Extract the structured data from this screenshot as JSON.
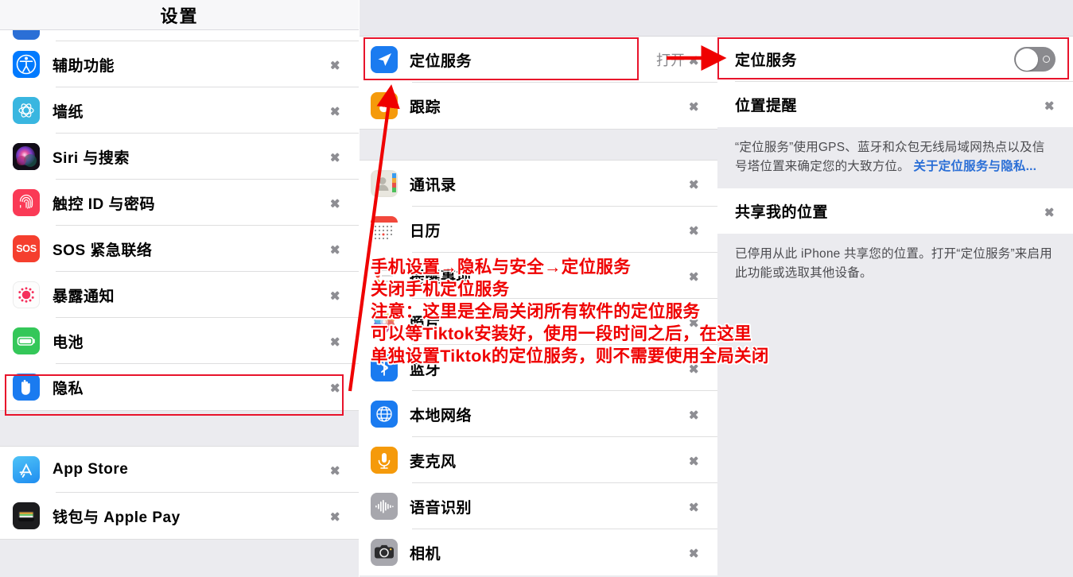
{
  "sidebar": {
    "title": "设置",
    "partial_top_row": "",
    "items": [
      {
        "label": "辅助功能",
        "icon": "accessibility-icon"
      },
      {
        "label": "墙纸",
        "icon": "wallpaper-icon"
      },
      {
        "label": "Siri 与搜索",
        "icon": "siri-icon"
      },
      {
        "label": "触控 ID 与密码",
        "icon": "touchid-icon"
      },
      {
        "label": "SOS 紧急联络",
        "icon": "sos-icon"
      },
      {
        "label": "暴露通知",
        "icon": "exposure-notification-icon"
      },
      {
        "label": "电池",
        "icon": "battery-icon"
      },
      {
        "label": "隐私",
        "icon": "privacy-hand-icon"
      }
    ],
    "items_group2": [
      {
        "label": "App Store",
        "icon": "appstore-icon"
      },
      {
        "label": "钱包与 Apple Pay",
        "icon": "wallet-icon"
      }
    ]
  },
  "middle": {
    "group1": [
      {
        "label": "定位服务",
        "detail": "打开",
        "icon": "location-arrow-icon",
        "has_chevron": true
      },
      {
        "label": "跟踪",
        "detail": "",
        "icon": "tracking-icon",
        "has_chevron": true
      }
    ],
    "group2": [
      {
        "label": "通讯录",
        "detail": "",
        "icon": "contacts-icon",
        "has_chevron": true
      },
      {
        "label": "日历",
        "detail": "",
        "icon": "calendar-icon",
        "has_chevron": true
      },
      {
        "label": "提醒事项",
        "detail": "",
        "icon": "reminders-icon",
        "has_chevron": true
      },
      {
        "label": "照片",
        "detail": "",
        "icon": "photos-icon",
        "has_chevron": true
      },
      {
        "label": "蓝牙",
        "detail": "",
        "icon": "bluetooth-icon",
        "has_chevron": true
      },
      {
        "label": "本地网络",
        "detail": "",
        "icon": "local-network-icon",
        "has_chevron": true
      },
      {
        "label": "麦克风",
        "detail": "",
        "icon": "microphone-icon",
        "has_chevron": true
      },
      {
        "label": "语音识别",
        "detail": "",
        "icon": "speech-recognition-icon",
        "has_chevron": true
      },
      {
        "label": "相机",
        "detail": "",
        "icon": "camera-icon",
        "has_chevron": true
      }
    ]
  },
  "right": {
    "location_services_label": "定位服务",
    "location_services_toggle": "off",
    "location_alerts_label": "位置提醒",
    "note_1_part1": "“定位服务”使用GPS、蓝牙和众包无线局域网热点以及信号塔位置来确定您的大致方位。 ",
    "note_1_link": "关于定位服务与隐私...",
    "share_location_label": "共享我的位置",
    "note_2": "已停用从此 iPhone 共享您的位置。打开“定位服务”来启用此功能或选取其他设备。"
  },
  "annotations": {
    "arrow_label": "打开",
    "lines": [
      "手机设置→隐私与安全→定位服务",
      "关闭手机定位服务",
      "注意：这里是全局关闭所有软件的定位服务",
      "可以等Tiktok安装好，使用一段时间之后，在这里",
      "单独设置Tiktok的定位服务，则不需要使用全局关闭"
    ],
    "accent_color": "#ef0000",
    "box_color": "#e8132b"
  }
}
